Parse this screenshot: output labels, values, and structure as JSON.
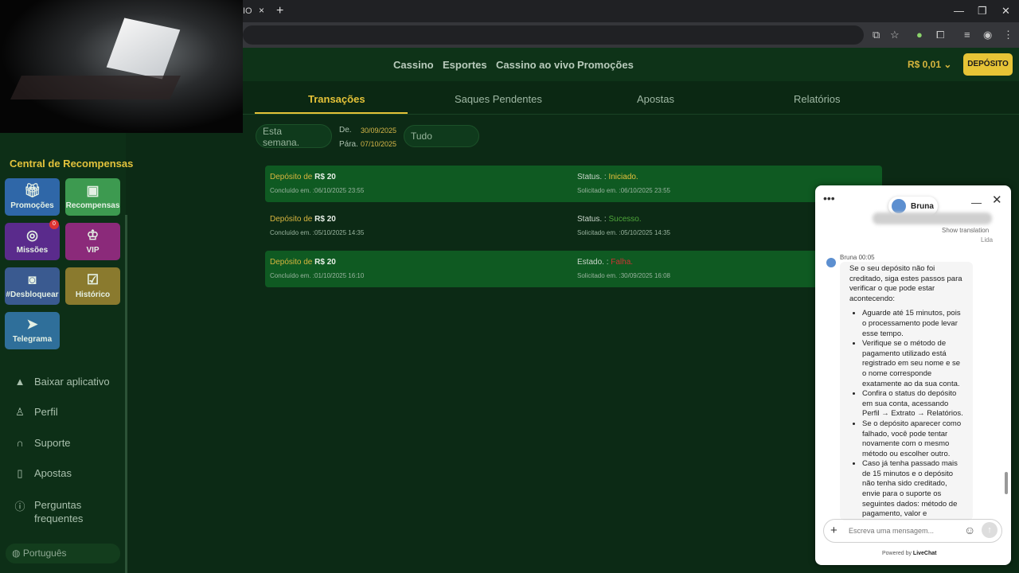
{
  "browser": {
    "tab_title_fragment": "IO",
    "tab_close": "×",
    "new_tab": "+",
    "minimize": "—",
    "restore": "❐",
    "close": "✕"
  },
  "header": {
    "nav": [
      "Cassino",
      "Esportes",
      "Cassino ao vivo",
      "Promoções"
    ],
    "balance": "R$ 0,01",
    "deposit_button": "DEPÓSITO"
  },
  "tabs": [
    {
      "label": "Transações",
      "active": true
    },
    {
      "label": "Saques Pendentes",
      "active": false
    },
    {
      "label": "Apostas",
      "active": false
    },
    {
      "label": "Relatórios",
      "active": false
    }
  ],
  "filters": {
    "period": "Esta semana.",
    "from_label": "De.",
    "from_date": "30/09/2025",
    "to_label": "Pára.",
    "to_date": "07/10/2025",
    "type": "Tudo"
  },
  "transactions": [
    {
      "title_prefix": "Depósito de",
      "amount": "R$ 20",
      "completed": "Concluído em. :06/10/2025 23:55",
      "status_label": "Status. :",
      "status_value": "Iniciado.",
      "status_color": "#e5c13c",
      "requested": "Solicitado em. :06/10/2025 23:55"
    },
    {
      "title_prefix": "Depósito de",
      "amount": "R$ 20",
      "completed": "Concluído em. :05/10/2025 14:35",
      "status_label": "Status. :",
      "status_value": "Sucesso.",
      "status_color": "#4ea53a",
      "requested": "Solicitado em. :05/10/2025 14:35"
    },
    {
      "title_prefix": "Depósito de",
      "amount": "R$ 20",
      "completed": "Concluído em. :01/10/2025 16:10",
      "status_label": "Estado. :",
      "status_value": "Falha.",
      "status_color": "#cc3333",
      "requested": "Solicitado em. :30/09/2025 16:08"
    }
  ],
  "sidebar": {
    "rewards_title": "Central de Recompensas",
    "tiles": [
      {
        "label": "Promoções",
        "icon": "gift-icon"
      },
      {
        "label": "Recompensas",
        "icon": "wallet-icon"
      },
      {
        "label": "Missões",
        "icon": "target-icon"
      },
      {
        "label": "VIP",
        "icon": "crown-icon"
      },
      {
        "label": "#Desbloquear",
        "icon": "camera-icon"
      },
      {
        "label": "Histórico",
        "icon": "clipboard-icon"
      },
      {
        "label": "Telegrama",
        "icon": "telegram-icon"
      }
    ],
    "missions_badge": "0",
    "menu": [
      {
        "label": "Baixar aplicativo",
        "icon": "android-icon"
      },
      {
        "label": "Perfil",
        "icon": "user-icon"
      },
      {
        "label": "Suporte",
        "icon": "headset-icon"
      },
      {
        "label": "Apostas",
        "icon": "book-icon"
      },
      {
        "label": "Perguntas frequentes",
        "icon": "help-icon"
      }
    ],
    "language": "Português"
  },
  "chat": {
    "agent_name": "Bruna",
    "show_translation": "Show translation",
    "read_label": "Lida",
    "message_meta": "Bruna 00:05",
    "intro": "Se o seu depósito não foi creditado, siga estes passos para verificar o que pode estar acontecendo:",
    "steps": [
      "Aguarde até 15 minutos, pois o processamento pode levar esse tempo.",
      "Verifique se o método de pagamento utilizado está registrado em seu nome e se o nome corresponde exatamente ao da sua conta.",
      "Confira o status do depósito em sua conta, acessando Perfil → Extrato → Relatórios.",
      "Se o depósito aparecer como falhado, você pode tentar novamente com o mesmo método ou escolher outro.",
      "Caso já tenha passado mais de 15 minutos e o depósito não tenha sido creditado, envie para o suporte os seguintes dados: método de pagamento, valor e"
    ],
    "input_placeholder": "Escreva uma mensagem...",
    "powered_by": "Powered by",
    "powered_brand": "LiveChat"
  }
}
